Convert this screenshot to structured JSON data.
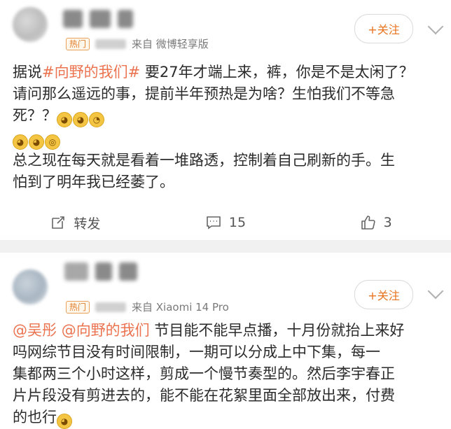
{
  "posts": [
    {
      "badge": "热门",
      "source": "来自 微博轻享版",
      "follow_label": "+关注",
      "text_intro": "据说",
      "hashtag": "#向野的我们#",
      "text_line1_rest": " 要27年才端上来，裤，你是不是太闲了？",
      "text_line2": "请问那么遥远的事，提前半年预热是为啥？生怕我们不等急",
      "text_line3": "死？？",
      "text_line5": "总之现在每天就是看着一堆路透，控制着自己刷新的手。生",
      "text_line6": "怕到了明年我已经萎了。",
      "actions": {
        "repost_label": "转发",
        "comment_count": "15",
        "like_count": "3"
      }
    },
    {
      "badge": "热门",
      "source": "来自 Xiaomi 14 Pro",
      "follow_label": "+关注",
      "mention1": "@吴彤",
      "mention2": "@向野的我们",
      "text_line1_rest": " 节目能不能早点播，十月份就抬上来好",
      "text_line2": "吗网综节目没有时间限制，一期可以分成上中下集，每一",
      "text_line3": "集都两三个小时这样，剪成一个慢节奏型的。然后李宇春正",
      "text_line4": "片片段没有剪进去的，能不能在花絮里面全部放出来，付费",
      "text_line5": "的也行"
    }
  ],
  "icons": [
    "repost-icon",
    "comment-icon",
    "like-icon",
    "chevron-down-icon"
  ]
}
